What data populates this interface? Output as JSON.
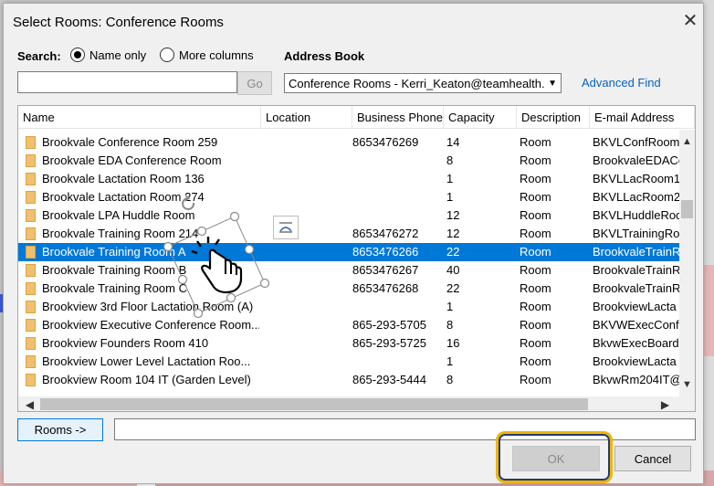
{
  "dialog": {
    "title": "Select Rooms: Conference Rooms",
    "close_icon": "close-icon"
  },
  "search": {
    "label": "Search:",
    "name_only": "Name only",
    "more_columns": "More columns",
    "input_value": "",
    "go_label": "Go"
  },
  "address_book": {
    "label": "Address Book",
    "selected": "Conference Rooms - Kerri_Keaton@teamhealth.",
    "advanced_find": "Advanced Find"
  },
  "columns": [
    "Name",
    "Location",
    "Business Phone",
    "Capacity",
    "Description",
    "E-mail Address"
  ],
  "rows": [
    {
      "name": "Brookvale Conference Room 259",
      "location": "",
      "phone": "8653476269",
      "capacity": "14",
      "description": "Room",
      "email": "BKVLConfRoom"
    },
    {
      "name": "Brookvale EDA Conference Room",
      "location": "",
      "phone": "",
      "capacity": "8",
      "description": "Room",
      "email": "BrookvaleEDACo"
    },
    {
      "name": "Brookvale Lactation Room 136",
      "location": "",
      "phone": "",
      "capacity": "1",
      "description": "Room",
      "email": "BKVLLacRoom1"
    },
    {
      "name": "Brookvale Lactation Room 274",
      "location": "",
      "phone": "",
      "capacity": "1",
      "description": "Room",
      "email": "BKVLLacRoom2"
    },
    {
      "name": "Brookvale LPA Huddle Room",
      "location": "",
      "phone": "",
      "capacity": "12",
      "description": "Room",
      "email": "BKVLHuddleRoo"
    },
    {
      "name": "Brookvale Training Room 214",
      "location": "",
      "phone": "8653476272",
      "capacity": "12",
      "description": "Room",
      "email": "BKVLTrainingRo"
    },
    {
      "name": "Brookvale Training Room A",
      "location": "",
      "phone": "8653476266",
      "capacity": "22",
      "description": "Room",
      "email": "BrookvaleTrainR",
      "selected": true
    },
    {
      "name": "Brookvale Training Room B",
      "location": "",
      "phone": "8653476267",
      "capacity": "40",
      "description": "Room",
      "email": "BrookvaleTrainR"
    },
    {
      "name": "Brookvale Training Room C",
      "location": "",
      "phone": "8653476268",
      "capacity": "22",
      "description": "Room",
      "email": "BrookvaleTrainR"
    },
    {
      "name": "Brookview 3rd Floor Lactation Room (A)",
      "location": "",
      "phone": "",
      "capacity": "1",
      "description": "Room",
      "email": "BrookviewLacta"
    },
    {
      "name": "Brookview Executive Conference Room...",
      "location": "",
      "phone": "865-293-5705",
      "capacity": "8",
      "description": "Room",
      "email": "BKVWExecConfR"
    },
    {
      "name": "Brookview Founders Room 410",
      "location": "",
      "phone": "865-293-5725",
      "capacity": "16",
      "description": "Room",
      "email": "BkvwExecBoardR"
    },
    {
      "name": "Brookview Lower Level Lactation Roo...",
      "location": "",
      "phone": "",
      "capacity": "1",
      "description": "Room",
      "email": "BrookviewLacta"
    },
    {
      "name": "Brookview Room 104 IT (Garden Level)",
      "location": "",
      "phone": "865-293-5444",
      "capacity": "8",
      "description": "Room",
      "email": "BkvwRm204IT@"
    }
  ],
  "footer": {
    "rooms_button": "Rooms ->",
    "rooms_value": "",
    "ok": "OK",
    "cancel": "Cancel"
  }
}
